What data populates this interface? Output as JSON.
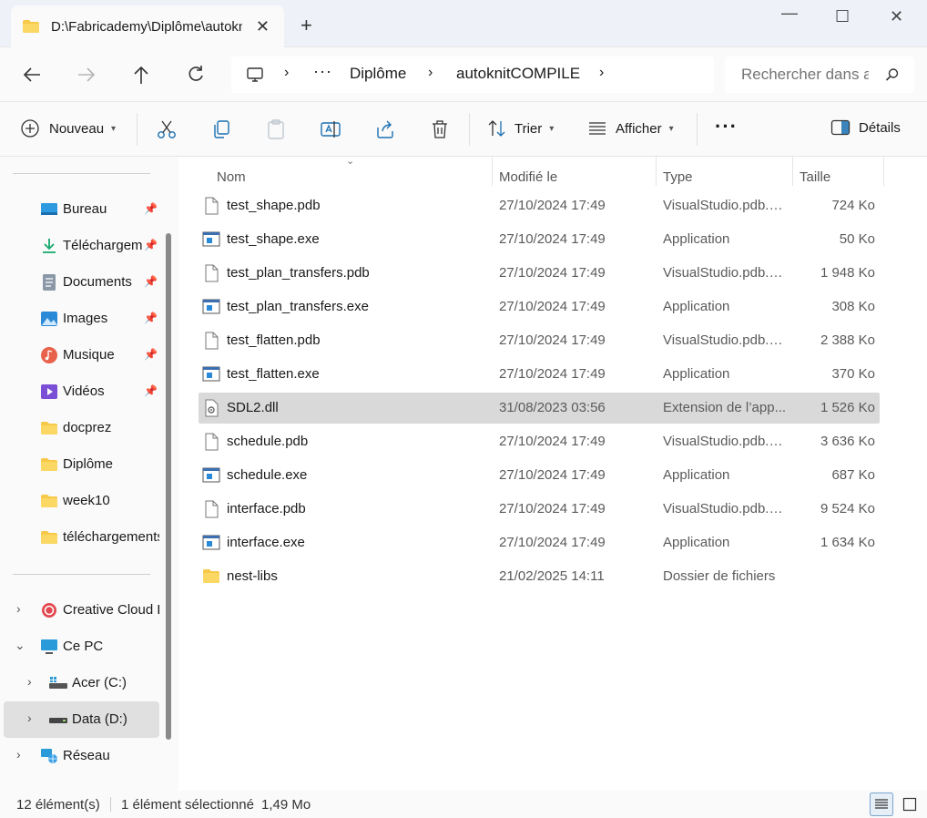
{
  "window": {
    "tab_title": "D:\\Fabricademy\\Diplôme\\autoknitCOMPILE",
    "close_tab": "✕",
    "new_tab": "+",
    "minimize": "—",
    "maximize": "☐",
    "close": "✕"
  },
  "nav": {
    "breadcrumb": [
      "Diplôme",
      "autoknitCOMPILE"
    ],
    "ellipsis": "···",
    "search_placeholder": "Rechercher dans autoknitCOMPILE"
  },
  "toolbar": {
    "new_label": "Nouveau",
    "sort_label": "Trier",
    "view_label": "Afficher",
    "more_label": "···",
    "details_label": "Détails"
  },
  "sidebar": {
    "quick_access": [
      {
        "label": "Bureau",
        "icon": "desktop-icon",
        "pinned": true
      },
      {
        "label": "Téléchargements",
        "icon": "download-icon",
        "pinned": true
      },
      {
        "label": "Documents",
        "icon": "documents-icon",
        "pinned": true
      },
      {
        "label": "Images",
        "icon": "images-icon",
        "pinned": true
      },
      {
        "label": "Musique",
        "icon": "music-icon",
        "pinned": true
      },
      {
        "label": "Vidéos",
        "icon": "videos-icon",
        "pinned": true
      },
      {
        "label": "docprez",
        "icon": "folder-icon",
        "pinned": false
      },
      {
        "label": "Diplôme",
        "icon": "folder-icon",
        "pinned": false
      },
      {
        "label": "week10",
        "icon": "folder-icon",
        "pinned": false
      },
      {
        "label": "téléchargements",
        "icon": "folder-icon",
        "pinned": false
      }
    ],
    "tree": [
      {
        "label": "Creative Cloud Files",
        "icon": "creative-cloud-icon",
        "expanded": false
      },
      {
        "label": "Ce PC",
        "icon": "this-pc-icon",
        "expanded": true
      },
      {
        "label": "Acer (C:)",
        "icon": "drive-c-icon",
        "expanded": false
      },
      {
        "label": "Data (D:)",
        "icon": "drive-d-icon",
        "expanded": false
      },
      {
        "label": "Réseau",
        "icon": "network-icon",
        "expanded": false
      }
    ]
  },
  "columns": {
    "name": "Nom",
    "modified": "Modifié le",
    "type": "Type",
    "size": "Taille"
  },
  "files": [
    {
      "name": "test_shape.pdb",
      "modified": "27/10/2024 17:49",
      "type": "VisualStudio.pdb.3...",
      "size": "724 Ko",
      "kind": "file"
    },
    {
      "name": "test_shape.exe",
      "modified": "27/10/2024 17:49",
      "type": "Application",
      "size": "50 Ko",
      "kind": "exe"
    },
    {
      "name": "test_plan_transfers.pdb",
      "modified": "27/10/2024 17:49",
      "type": "VisualStudio.pdb.3...",
      "size": "1 948 Ko",
      "kind": "file"
    },
    {
      "name": "test_plan_transfers.exe",
      "modified": "27/10/2024 17:49",
      "type": "Application",
      "size": "308 Ko",
      "kind": "exe"
    },
    {
      "name": "test_flatten.pdb",
      "modified": "27/10/2024 17:49",
      "type": "VisualStudio.pdb.3...",
      "size": "2 388 Ko",
      "kind": "file"
    },
    {
      "name": "test_flatten.exe",
      "modified": "27/10/2024 17:49",
      "type": "Application",
      "size": "370 Ko",
      "kind": "exe"
    },
    {
      "name": "SDL2.dll",
      "modified": "31/08/2023 03:56",
      "type": "Extension de l’app...",
      "size": "1 526 Ko",
      "kind": "dll",
      "selected": true
    },
    {
      "name": "schedule.pdb",
      "modified": "27/10/2024 17:49",
      "type": "VisualStudio.pdb.3...",
      "size": "3 636 Ko",
      "kind": "file"
    },
    {
      "name": "schedule.exe",
      "modified": "27/10/2024 17:49",
      "type": "Application",
      "size": "687 Ko",
      "kind": "exe"
    },
    {
      "name": "interface.pdb",
      "modified": "27/10/2024 17:49",
      "type": "VisualStudio.pdb.3...",
      "size": "9 524 Ko",
      "kind": "file"
    },
    {
      "name": "interface.exe",
      "modified": "27/10/2024 17:49",
      "type": "Application",
      "size": "1 634 Ko",
      "kind": "exe"
    },
    {
      "name": "nest-libs",
      "modified": "21/02/2025 14:11",
      "type": "Dossier de fichiers",
      "size": "",
      "kind": "folder"
    }
  ],
  "status": {
    "count": "12 élément(s)",
    "selected": "1 élément sélectionné",
    "size": "1,49 Mo"
  },
  "colors": {
    "titlebar": "#eef2f8",
    "folder": "#f7c948",
    "selection": "#d9d9d9",
    "accent": "#1a73c9"
  }
}
